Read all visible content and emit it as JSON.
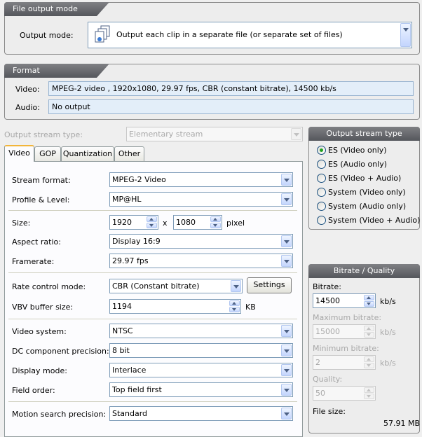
{
  "file_output_mode": {
    "header": "File output mode",
    "output_mode_label": "Output mode:",
    "output_mode_value": "Output each clip in a separate file (or separate set of files)",
    "icon": "files-icon"
  },
  "format": {
    "header": "Format",
    "video_label": "Video:",
    "video_value": "MPEG-2 video , 1920x1080, 29.97 fps, CBR (constant bitrate), 14500 kb/s",
    "audio_label": "Audio:",
    "audio_value": "No output"
  },
  "output_stream": {
    "type_label": "Output stream type:",
    "type_value": "Elementary stream"
  },
  "tabs": [
    {
      "label": "Video"
    },
    {
      "label": "GOP"
    },
    {
      "label": "Quantization"
    },
    {
      "label": "Other"
    }
  ],
  "video": {
    "stream_format_label": "Stream format:",
    "stream_format_value": "MPEG-2 Video",
    "profile_label": "Profile & Level:",
    "profile_value": "MP@HL",
    "size_label": "Size:",
    "width_value": "1920",
    "x_label": "x",
    "height_value": "1080",
    "pixel_label": "pixel",
    "aspect_label": "Aspect ratio:",
    "aspect_value": "Display 16:9",
    "framerate_label": "Framerate:",
    "framerate_value": "29.97 fps",
    "rate_control_label": "Rate control mode:",
    "rate_control_value": "CBR (Constant bitrate)",
    "settings_button": "Settings",
    "vbv_label": "VBV buffer size:",
    "vbv_value": "1194",
    "vbv_unit": "KB",
    "video_system_label": "Video system:",
    "video_system_value": "NTSC",
    "dc_label": "DC component precision:",
    "dc_value": "8 bit",
    "display_mode_label": "Display mode:",
    "display_mode_value": "Interlace",
    "field_order_label": "Field order:",
    "field_order_value": "Top field first",
    "motion_label": "Motion search precision:",
    "motion_value": "Standard"
  },
  "output_stream_type_panel": {
    "header": "Output stream type",
    "options": [
      {
        "label": "ES (Video only)",
        "checked": true
      },
      {
        "label": "ES (Audio only)",
        "checked": false
      },
      {
        "label": "ES (Video + Audio)",
        "checked": false
      },
      {
        "label": "System (Video only)",
        "checked": false
      },
      {
        "label": "System (Audio only)",
        "checked": false
      },
      {
        "label": "System (Video + Audio)",
        "checked": false
      }
    ]
  },
  "bitrate_panel": {
    "header": "Bitrate / Quality",
    "bitrate_label": "Bitrate:",
    "bitrate_value": "14500",
    "bitrate_unit": "kb/s",
    "max_label": "Maximum bitrate:",
    "max_value": "15000",
    "max_unit": "kb/s",
    "min_label": "Minimum bitrate:",
    "min_value": "2",
    "min_unit": "kb/s",
    "quality_label": "Quality:",
    "quality_value": "50",
    "file_size_label": "File size:",
    "file_size_value": "57.91 MB"
  }
}
